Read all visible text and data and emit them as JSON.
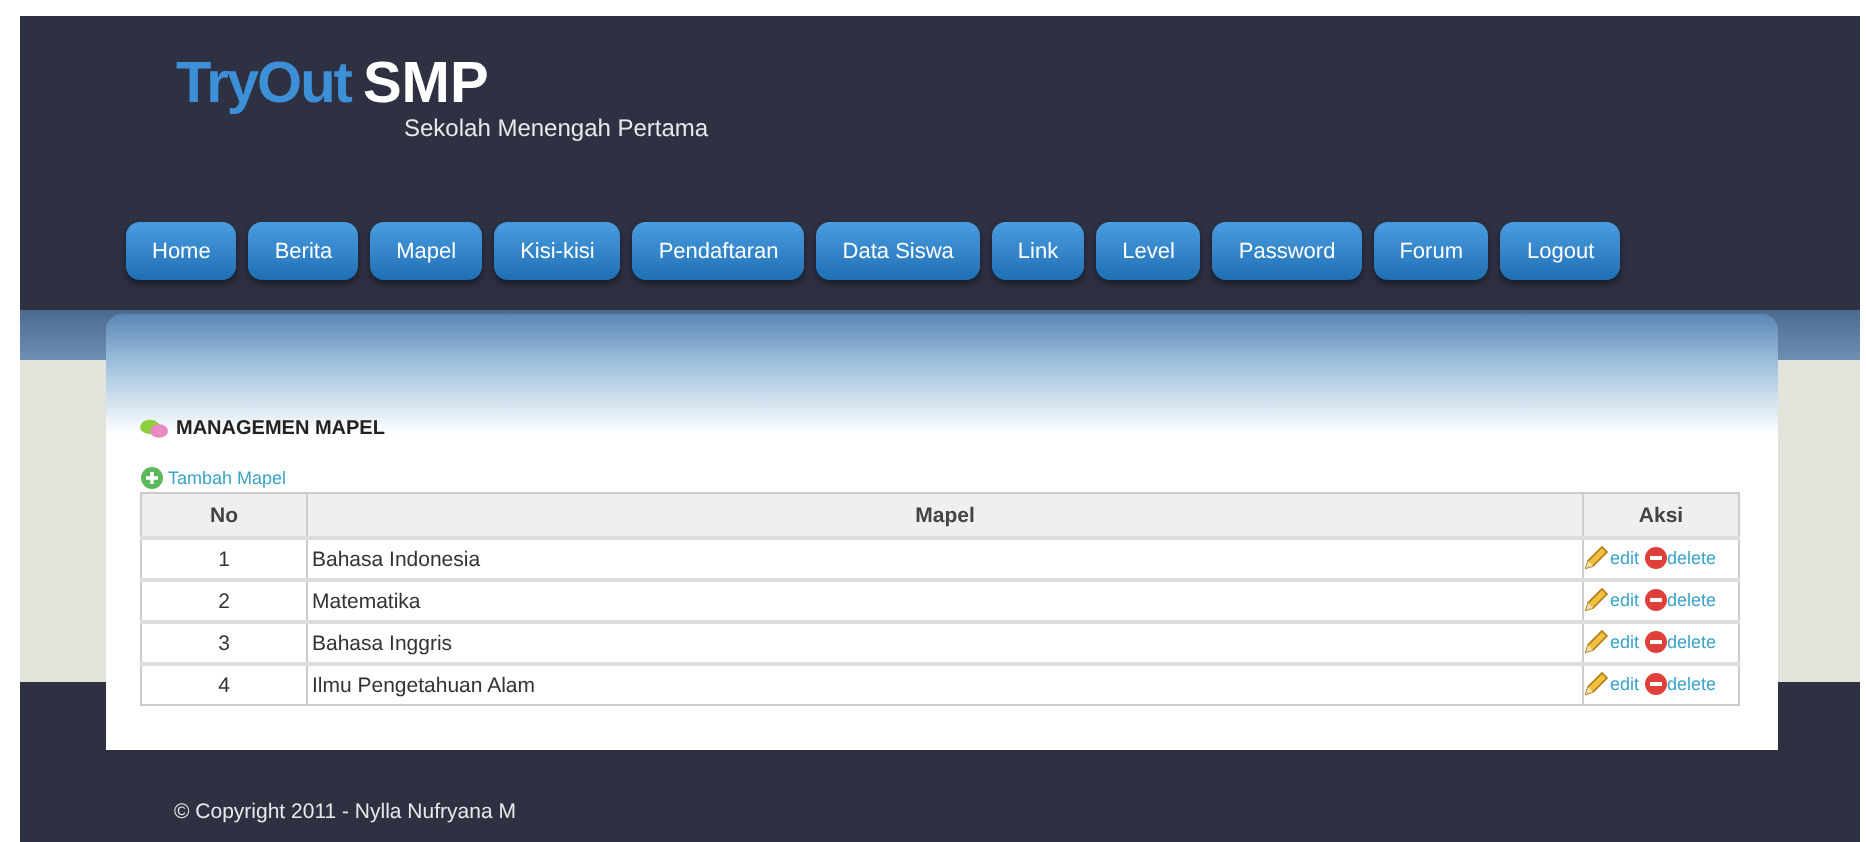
{
  "header": {
    "logo_primary": "TryOut",
    "logo_secondary": "SMP",
    "tagline": "Sekolah Menengah Pertama"
  },
  "nav": [
    "Home",
    "Berita",
    "Mapel",
    "Kisi-kisi",
    "Pendaftaran",
    "Data Siswa",
    "Link",
    "Level",
    "Password",
    "Forum",
    "Logout"
  ],
  "section": {
    "title": "MANAGEMEN MAPEL",
    "add_link": "Tambah Mapel"
  },
  "table": {
    "columns": [
      "No",
      "Mapel",
      "Aksi"
    ],
    "rows": [
      {
        "no": "1",
        "mapel": "Bahasa Indonesia",
        "edit": "edit",
        "delete": "delete"
      },
      {
        "no": "2",
        "mapel": "Matematika",
        "edit": "edit",
        "delete": "delete"
      },
      {
        "no": "3",
        "mapel": "Bahasa Inggris",
        "edit": "edit",
        "delete": "delete"
      },
      {
        "no": "4",
        "mapel": "Ilmu Pengetahuan Alam",
        "edit": "edit",
        "delete": "delete"
      }
    ]
  },
  "footer": {
    "copyright": "© Copyright 2011 - Nylla Nufryana M"
  }
}
